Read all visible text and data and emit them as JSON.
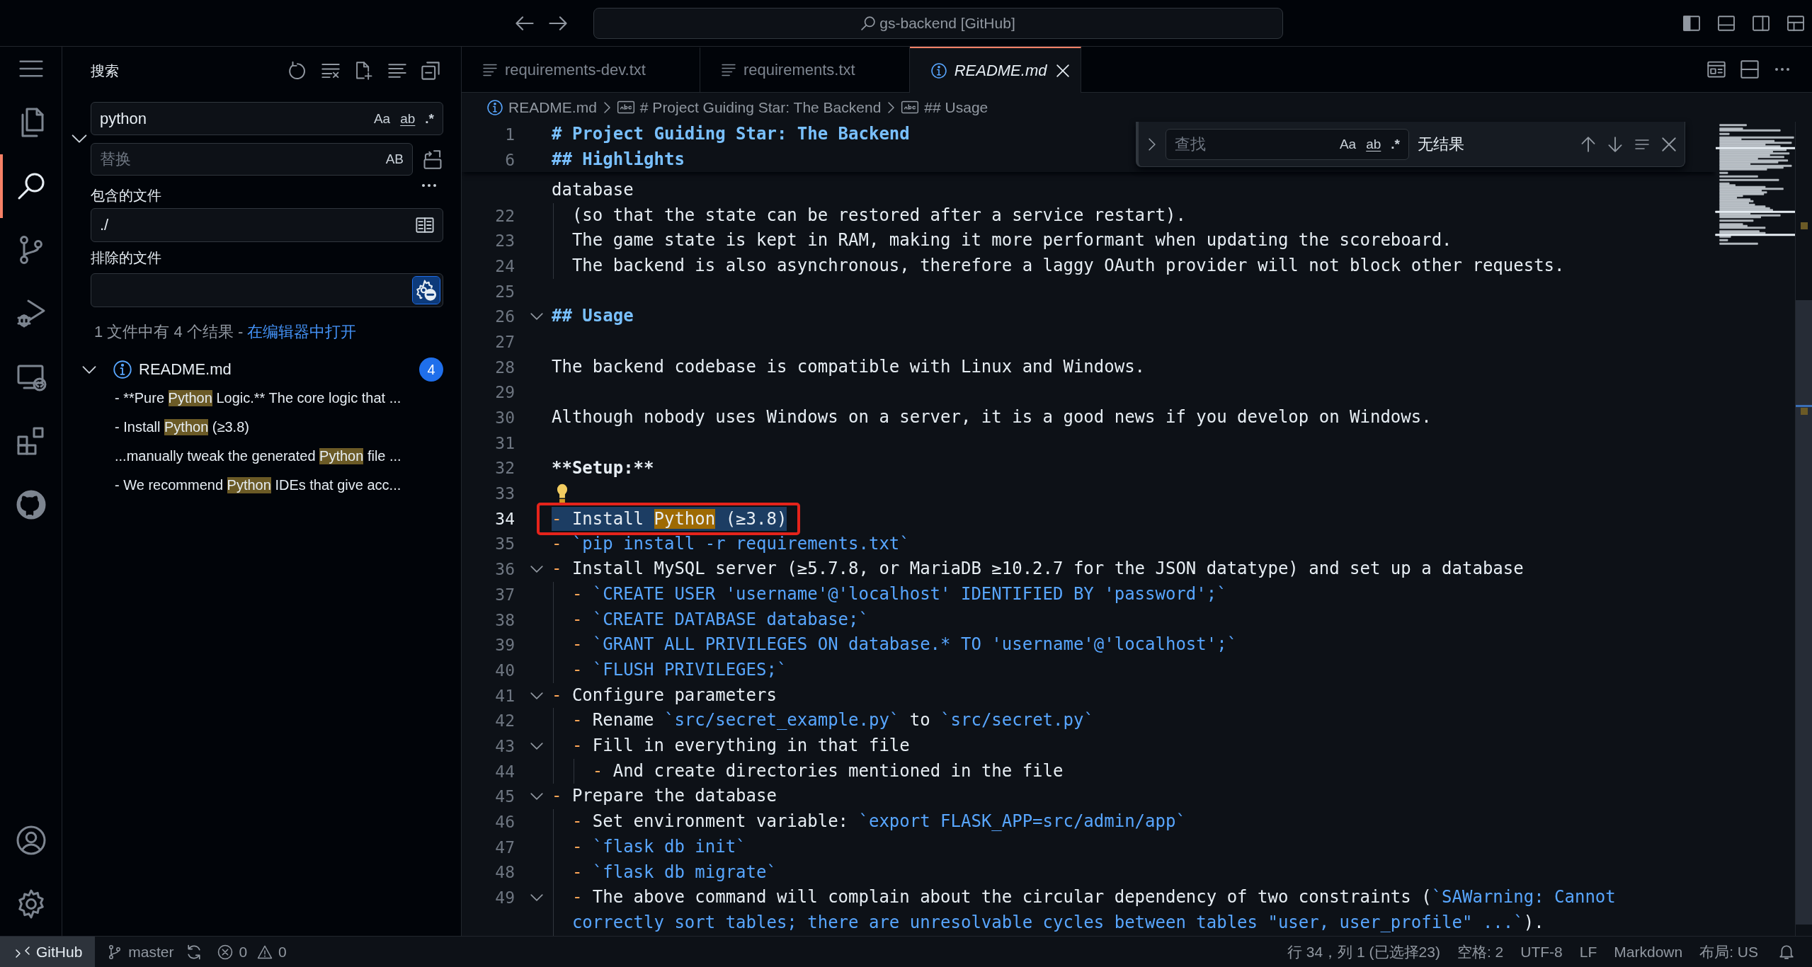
{
  "title_bar": {
    "title": "gs-backend [GitHub]"
  },
  "activity_bar": {
    "items": [
      {
        "kind": "explorer",
        "selected": false
      },
      {
        "kind": "search",
        "selected": true
      },
      {
        "kind": "source_control",
        "selected": false
      },
      {
        "kind": "run_debug",
        "selected": false
      },
      {
        "kind": "remote",
        "selected": false
      },
      {
        "kind": "extensions",
        "selected": false
      },
      {
        "kind": "github",
        "selected": false
      }
    ],
    "bottom_items": [
      {
        "kind": "account"
      },
      {
        "kind": "settings"
      }
    ]
  },
  "sidebar": {
    "title": "搜索",
    "search": {
      "value": "python",
      "toggles": [
        {
          "kind": "case",
          "label": "Aa",
          "selected": false
        },
        {
          "kind": "word",
          "label": "ab",
          "selected": false
        },
        {
          "kind": "regex",
          "label": ".*",
          "selected": false
        }
      ]
    },
    "replace": {
      "placeholder": "替换",
      "expanded": true,
      "toggles": [
        {
          "kind": "preserve_case",
          "label": "AB",
          "selected": false
        }
      ]
    },
    "include": {
      "label": "包含的文件",
      "value": "./"
    },
    "exclude": {
      "label": "排除的文件",
      "use_exclude_settings": true
    },
    "summary": {
      "text": "1 文件中有 4 个结果 - ",
      "link": "在编辑器中打开"
    },
    "results": [
      {
        "kind": "markdown",
        "file": "README.md",
        "count": "4",
        "expanded": true,
        "matches": [
          {
            "before": "- **Pure ",
            "match": "Python",
            "after": " Logic.** The core logic that ..."
          },
          {
            "before": "- Install ",
            "match": "Python",
            "after": " (≥3.8)"
          },
          {
            "before": "...manually tweak the generated ",
            "match": "Python",
            "after": " file ..."
          },
          {
            "before": "- We recommend ",
            "match": "Python",
            "after": " IDEs that give acc..."
          }
        ]
      }
    ]
  },
  "editor": {
    "tabs": [
      {
        "kind": "text",
        "label": "requirements-dev.txt",
        "selected": false,
        "preview": false
      },
      {
        "kind": "text",
        "label": "requirements.txt",
        "selected": false,
        "preview": false
      },
      {
        "kind": "markdown",
        "label": "README.md",
        "selected": true,
        "preview": true
      }
    ],
    "breadcrumb": [
      {
        "kind": "file",
        "label": "README.md"
      },
      {
        "kind": "heading",
        "label": "# Project Guiding Star: The Backend"
      },
      {
        "kind": "heading",
        "label": "## Usage"
      }
    ],
    "find": {
      "placeholder": "查找",
      "toggles": [
        {
          "kind": "case",
          "label": "Aa",
          "selected": false
        },
        {
          "kind": "word",
          "label": "ab",
          "selected": false
        },
        {
          "kind": "regex",
          "label": ".*",
          "selected": false
        }
      ],
      "result": "无结果"
    },
    "sticky_lines": [
      {
        "number": "1",
        "segments": [
          {
            "kind": "heading",
            "text": "# Project Guiding Star: The Backend"
          }
        ]
      },
      {
        "number": "6",
        "segments": [
          {
            "kind": "heading",
            "text": "## Highlights"
          }
        ]
      }
    ],
    "lines": [
      {
        "kind": "wrap",
        "foldable": false,
        "selected": false,
        "boxed": false,
        "lightbulb": false,
        "segments": [
          {
            "kind": "text",
            "text": "database"
          }
        ]
      },
      {
        "kind": "line",
        "number": "22",
        "foldable": false,
        "selected": false,
        "boxed": false,
        "lightbulb": false,
        "segments": [
          {
            "kind": "text",
            "text": "  (so that the state can be restored after a service restart)."
          }
        ]
      },
      {
        "kind": "line",
        "number": "23",
        "foldable": false,
        "selected": false,
        "boxed": false,
        "lightbulb": false,
        "segments": [
          {
            "kind": "text",
            "text": "  The game state is kept in RAM, making it more performant when updating the scoreboard."
          }
        ]
      },
      {
        "kind": "line",
        "number": "24",
        "foldable": false,
        "selected": false,
        "boxed": false,
        "lightbulb": false,
        "segments": [
          {
            "kind": "text",
            "text": "  The backend is also asynchronous, therefore a laggy OAuth provider will not block other requests."
          }
        ]
      },
      {
        "kind": "line",
        "number": "25",
        "foldable": false,
        "selected": false,
        "boxed": false,
        "lightbulb": false
      },
      {
        "kind": "line",
        "number": "26",
        "foldable": true,
        "selected": false,
        "boxed": false,
        "lightbulb": false,
        "segments": [
          {
            "kind": "heading",
            "text": "## Usage"
          }
        ]
      },
      {
        "kind": "line",
        "number": "27",
        "foldable": false,
        "selected": false,
        "boxed": false,
        "lightbulb": false
      },
      {
        "kind": "line",
        "number": "28",
        "foldable": false,
        "selected": false,
        "boxed": false,
        "lightbulb": false,
        "segments": [
          {
            "kind": "text",
            "text": "The backend codebase is compatible with Linux and Windows."
          }
        ]
      },
      {
        "kind": "line",
        "number": "29",
        "foldable": false,
        "selected": false,
        "boxed": false,
        "lightbulb": false
      },
      {
        "kind": "line",
        "number": "30",
        "foldable": false,
        "selected": false,
        "boxed": false,
        "lightbulb": false,
        "segments": [
          {
            "kind": "text",
            "text": "Although nobody uses Windows on a server, it is a good news if you develop on Windows."
          }
        ]
      },
      {
        "kind": "line",
        "number": "31",
        "foldable": false,
        "selected": false,
        "boxed": false,
        "lightbulb": false
      },
      {
        "kind": "line",
        "number": "32",
        "foldable": false,
        "selected": false,
        "boxed": false,
        "lightbulb": false,
        "segments": [
          {
            "kind": "bold",
            "text": "**Setup:**"
          }
        ]
      },
      {
        "kind": "line",
        "number": "33",
        "foldable": false,
        "selected": false,
        "boxed": false,
        "lightbulb": true
      },
      {
        "kind": "line",
        "number": "34",
        "foldable": false,
        "selected": true,
        "boxed": true,
        "lightbulb": false,
        "segments": [
          {
            "kind": "marker",
            "text": "- "
          },
          {
            "kind": "text",
            "text": "Install "
          },
          {
            "kind": "match",
            "text": "Python"
          },
          {
            "kind": "text",
            "text": " (≥3.8)"
          }
        ]
      },
      {
        "kind": "line",
        "number": "35",
        "foldable": false,
        "selected": false,
        "boxed": false,
        "lightbulb": false,
        "segments": [
          {
            "kind": "marker",
            "text": "- "
          },
          {
            "kind": "code",
            "text": "`pip install -r requirements.txt`"
          }
        ]
      },
      {
        "kind": "line",
        "number": "36",
        "foldable": true,
        "selected": false,
        "boxed": false,
        "lightbulb": false,
        "segments": [
          {
            "kind": "marker",
            "text": "- "
          },
          {
            "kind": "text",
            "text": "Install MySQL server (≥5.7.8, or MariaDB ≥10.2.7 for the JSON datatype) and set up a database"
          }
        ]
      },
      {
        "kind": "line",
        "number": "37",
        "foldable": false,
        "selected": false,
        "boxed": false,
        "lightbulb": false,
        "segments": [
          {
            "kind": "marker",
            "text": "  - "
          },
          {
            "kind": "code",
            "text": "`CREATE USER 'username'@'localhost' IDENTIFIED BY 'password';`"
          }
        ]
      },
      {
        "kind": "line",
        "number": "38",
        "foldable": false,
        "selected": false,
        "boxed": false,
        "lightbulb": false,
        "segments": [
          {
            "kind": "marker",
            "text": "  - "
          },
          {
            "kind": "code",
            "text": "`CREATE DATABASE database;`"
          }
        ]
      },
      {
        "kind": "line",
        "number": "39",
        "foldable": false,
        "selected": false,
        "boxed": false,
        "lightbulb": false,
        "segments": [
          {
            "kind": "marker",
            "text": "  - "
          },
          {
            "kind": "code",
            "text": "`GRANT ALL PRIVILEGES ON database.* TO 'username'@'localhost';`"
          }
        ]
      },
      {
        "kind": "line",
        "number": "40",
        "foldable": false,
        "selected": false,
        "boxed": false,
        "lightbulb": false,
        "segments": [
          {
            "kind": "marker",
            "text": "  - "
          },
          {
            "kind": "code",
            "text": "`FLUSH PRIVILEGES;`"
          }
        ]
      },
      {
        "kind": "line",
        "number": "41",
        "foldable": true,
        "selected": false,
        "boxed": false,
        "lightbulb": false,
        "segments": [
          {
            "kind": "marker",
            "text": "- "
          },
          {
            "kind": "text",
            "text": "Configure parameters"
          }
        ]
      },
      {
        "kind": "line",
        "number": "42",
        "foldable": false,
        "selected": false,
        "boxed": false,
        "lightbulb": false,
        "segments": [
          {
            "kind": "marker",
            "text": "  - "
          },
          {
            "kind": "text",
            "text": "Rename "
          },
          {
            "kind": "code",
            "text": "`src/secret_example.py`"
          },
          {
            "kind": "text",
            "text": " to "
          },
          {
            "kind": "code",
            "text": "`src/secret.py`"
          }
        ]
      },
      {
        "kind": "line",
        "number": "43",
        "foldable": true,
        "selected": false,
        "boxed": false,
        "lightbulb": false,
        "segments": [
          {
            "kind": "marker",
            "text": "  - "
          },
          {
            "kind": "text",
            "text": "Fill in everything in that file"
          }
        ]
      },
      {
        "kind": "line",
        "number": "44",
        "foldable": false,
        "selected": false,
        "boxed": false,
        "lightbulb": false,
        "segments": [
          {
            "kind": "marker",
            "text": "    - "
          },
          {
            "kind": "text",
            "text": "And create directories mentioned in the file"
          }
        ]
      },
      {
        "kind": "line",
        "number": "45",
        "foldable": true,
        "selected": false,
        "boxed": false,
        "lightbulb": false,
        "segments": [
          {
            "kind": "marker",
            "text": "- "
          },
          {
            "kind": "text",
            "text": "Prepare the database"
          }
        ]
      },
      {
        "kind": "line",
        "number": "46",
        "foldable": false,
        "selected": false,
        "boxed": false,
        "lightbulb": false,
        "segments": [
          {
            "kind": "marker",
            "text": "  - "
          },
          {
            "kind": "text",
            "text": "Set environment variable: "
          },
          {
            "kind": "code",
            "text": "`export FLASK_APP=src/admin/app`"
          }
        ]
      },
      {
        "kind": "line",
        "number": "47",
        "foldable": false,
        "selected": false,
        "boxed": false,
        "lightbulb": false,
        "segments": [
          {
            "kind": "marker",
            "text": "  - "
          },
          {
            "kind": "code",
            "text": "`flask db init`"
          }
        ]
      },
      {
        "kind": "line",
        "number": "48",
        "foldable": false,
        "selected": false,
        "boxed": false,
        "lightbulb": false,
        "segments": [
          {
            "kind": "marker",
            "text": "  - "
          },
          {
            "kind": "code",
            "text": "`flask db migrate`"
          }
        ]
      },
      {
        "kind": "line",
        "number": "49",
        "foldable": true,
        "selected": false,
        "boxed": false,
        "lightbulb": false,
        "segments": [
          {
            "kind": "marker",
            "text": "  - "
          },
          {
            "kind": "text",
            "text": "The above command will complain about the circular dependency of two constraints ("
          },
          {
            "kind": "code",
            "text": "`SAWarning: Cannot"
          }
        ]
      },
      {
        "kind": "wrap",
        "foldable": false,
        "selected": false,
        "boxed": false,
        "lightbulb": false,
        "segments": [
          {
            "kind": "code",
            "text": "  correctly sort tables; there are unresolvable cycles between tables \"user, user_profile\" ...`"
          },
          {
            "kind": "text",
            "text": ")."
          }
        ]
      }
    ]
  },
  "status_bar": {
    "remote": "GitHub",
    "branch": "master",
    "errors": "0",
    "warnings": "0",
    "items": [
      "行 34，列 1 (已选择23)",
      "空格: 2",
      "UTF-8",
      "LF",
      "Markdown",
      "布局: US"
    ]
  }
}
